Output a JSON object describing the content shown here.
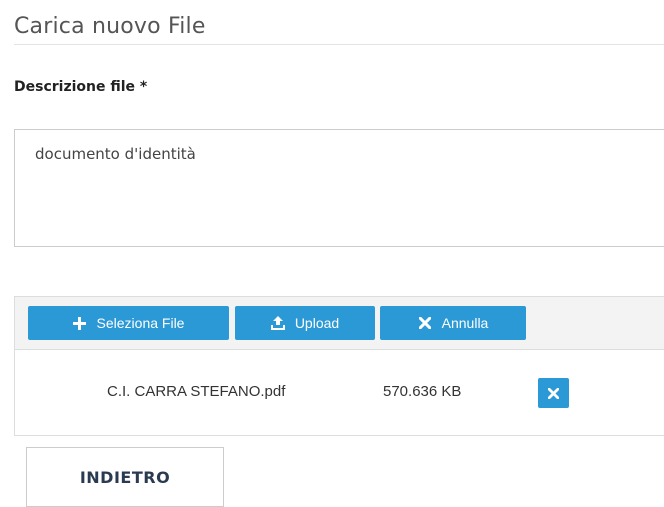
{
  "page": {
    "title": "Carica nuovo File"
  },
  "form": {
    "description_label": "Descrizione file *",
    "description_value": "documento d'identità"
  },
  "uploader": {
    "toolbar": {
      "select_label": "Seleziona File",
      "upload_label": "Upload",
      "cancel_label": "Annulla",
      "select_icon": "plus-icon",
      "upload_icon": "upload-icon",
      "cancel_icon": "close-icon"
    },
    "files": [
      {
        "name": "C.I. CARRA STEFANO.pdf",
        "size": "570.636 KB",
        "remove_icon": "close-icon"
      }
    ]
  },
  "actions": {
    "back_label": "INDIETRO"
  },
  "colors": {
    "accent": "#2b99d6",
    "toolbar_bg": "#f3f3f3",
    "border": "#cccccc"
  }
}
